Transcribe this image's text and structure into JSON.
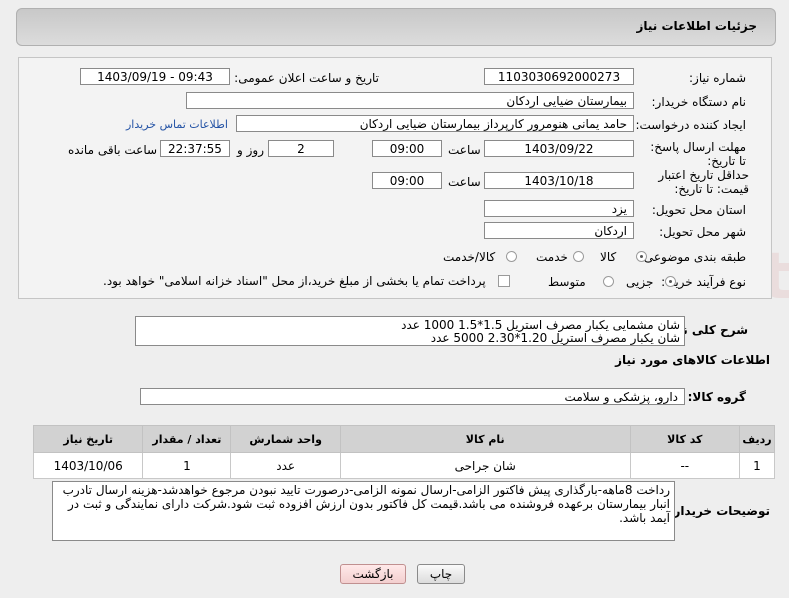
{
  "header": {
    "title": "جزئیات اطلاعات نیاز"
  },
  "form": {
    "need_number_label": "شماره نیاز:",
    "need_number": "1103030692000273",
    "announce_label": "تاریخ و ساعت اعلان عمومی:",
    "announce_value": "1403/09/19 - 09:43",
    "buyer_org_label": "نام دستگاه خریدار:",
    "buyer_org": "بیمارستان ضیایی اردکان",
    "creator_label": "ایجاد کننده درخواست:",
    "creator": "حامد یمانی هنومرور کارپرداز بیمارستان ضیایی اردکان",
    "contact_link": "اطلاعات تماس خریدار",
    "reply_deadline_label": "مهلت ارسال پاسخ: تا تاریخ:",
    "reply_date": "1403/09/22",
    "time_label": "ساعت",
    "reply_time": "09:00",
    "days_value": "2",
    "days_label": "روز و",
    "remaining_value": "22:37:55",
    "remaining_label": "ساعت باقی مانده",
    "price_validity_label": "حداقل تاریخ اعتبار قیمت: تا تاریخ:",
    "validity_date": "1403/10/18",
    "validity_time": "09:00",
    "province_label": "استان محل تحویل:",
    "province": "یزد",
    "city_label": "شهر محل تحویل:",
    "city": "اردکان",
    "category_label": "طبقه بندی موضوعی:",
    "category_options": [
      "کالا",
      "خدمت",
      "کالا/خدمت"
    ],
    "category_selected": "کالا",
    "process_label": "نوع فرآیند خرید :",
    "process_options": [
      "جزیی",
      "متوسط"
    ],
    "process_selected": "جزیی",
    "payment_note": "پرداخت تمام یا بخشی از مبلغ خرید،از محل \"اسناد خزانه اسلامی\" خواهد بود."
  },
  "description": {
    "label": "شرح کلی نیاز:",
    "line1": "شان مشمایی یکبار مصرف استریل  1.5*1.5    1000 عدد",
    "line2": "شان یکبار مصرف استریل 1.20*2.30     5000 عدد"
  },
  "goods": {
    "section_title": "اطلاعات کالاهای مورد نیاز",
    "group_label": "گروه کالا:",
    "group_value": "دارو، پزشکی و سلامت",
    "columns": [
      "ردیف",
      "کد کالا",
      "نام کالا",
      "واحد شمارش",
      "تعداد / مقدار",
      "تاریخ نیاز"
    ],
    "rows": [
      {
        "row": "1",
        "code": "--",
        "name": "شان جراحی",
        "unit": "عدد",
        "qty": "1",
        "date": "1403/10/06"
      }
    ]
  },
  "buyer_notes": {
    "label": "توضیحات خریدار:",
    "text": "رداخت 8ماهه-بارگذاری پیش فاکتور الزامی-ارسال نمونه الزامی-درصورت تایید نبودن مرجوع خواهدشد-هزینه ارسال تادرب انبار بیمارستان برعهده فروشنده می باشد.قیمت کل فاکتور بدون ارزش افزوده ثبت شود.شرکت دارای نمایندگی و ثبت در آیمد باشد."
  },
  "buttons": {
    "print": "چاپ",
    "back": "بازگشت"
  },
  "colors": {
    "link": "#2453a5",
    "header_bg": "#d0d0d0"
  }
}
